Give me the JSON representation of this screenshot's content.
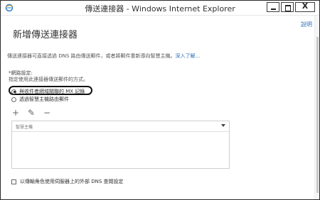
{
  "window": {
    "title": "傳送連接器 - Windows Internet Explorer",
    "minimize": "–",
    "close": "X"
  },
  "help": "說明",
  "page_title": "新增傳送連接器",
  "description": {
    "text": "傳送連接器可直接透過 DNS 路由傳送郵件，或者將郵件重新導向智慧主機。",
    "more_link": "深入了解..."
  },
  "network_settings": {
    "label": "*網路設定:",
    "hint": "指定使用此連接器傳送郵件的方式。",
    "options": [
      {
        "label": "與收件者網域關聯的 MX 記錄",
        "checked": true
      },
      {
        "label": "透過智慧主機路由郵件",
        "checked": false
      }
    ]
  },
  "toolbar": {
    "add": "+",
    "edit": "✎",
    "remove": "−"
  },
  "smart_host_grid": {
    "column": "智慧主機"
  },
  "external_dns_checkbox": {
    "label": "以傳輸角色使用伺服器上的外部 DNS 查閱設定",
    "checked": false
  }
}
